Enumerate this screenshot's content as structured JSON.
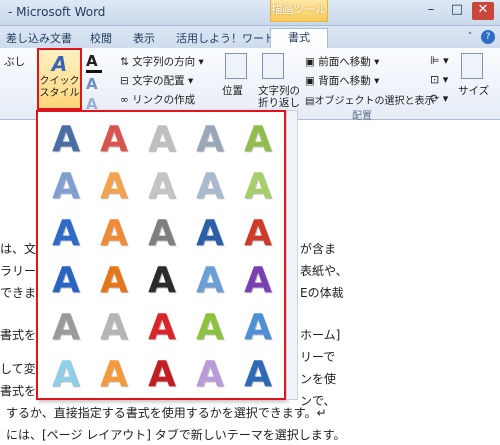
{
  "window": {
    "title": "- Microsoft Word",
    "context_tab": "描画ツール",
    "min": "–",
    "max": "□",
    "close": "✕"
  },
  "tabs": [
    "差し込み文書",
    "校閲",
    "表示",
    "活用しよう！ワード",
    "書式"
  ],
  "ribbon": {
    "left_cut": "ぶし",
    "quick_style": {
      "line1": "クイック",
      "line2": "スタイル"
    },
    "text_direction": "文字列の方向",
    "text_align": "文字の配置",
    "create_link": "リンクの作成",
    "position": "位置",
    "wrap_line1": "文字列の",
    "wrap_line2": "折り返し",
    "bring_forward": "前面へ移動",
    "send_backward": "背面へ移動",
    "selection_pane": "オブジェクトの選択と表示",
    "group_arrange": "配置",
    "size": "サイズ"
  },
  "document": {
    "lines": [
      "は、文字",
      "ラリーを",
      "できます",
      "書式を変",
      "して変更す",
      "書式を設定す",
      "するか、直接指定する書式を使用するかを選択できます。↵",
      "には、[ページ レイアウト] タブで新しいテーマを選択します。"
    ],
    "right_lines": [
      "が含ま",
      "表紙や、",
      "Eの体裁",
      "ホーム]",
      "リーで",
      "ンを使",
      "ンで、"
    ]
  },
  "gallery": {
    "letter": "A",
    "colors": [
      [
        "#4a6fa5",
        "#d9534f",
        "#bfbfbf",
        "#9aa7b8",
        "#8fbf4a"
      ],
      [
        "#7f9fd0",
        "#f5a24d",
        "#c4c4c4",
        "#a9b9cf",
        "#a6cf6b"
      ],
      [
        "#2f6bc8",
        "#f08a35",
        "#7f7f7f",
        "#2b5fa8",
        "#d03a2a"
      ],
      [
        "#2a64c0",
        "#e5761a",
        "#2b2b2b",
        "#6a9fd8",
        "#7a3fb0"
      ],
      [
        "#9a9a9a",
        "#b5b5b5",
        "#d9242a",
        "#8dc23f",
        "#4f8fd8"
      ],
      [
        "#8ed0e8",
        "#f29a3c",
        "#c21f24",
        "#b89bd8",
        "#2f6ab8"
      ]
    ]
  }
}
